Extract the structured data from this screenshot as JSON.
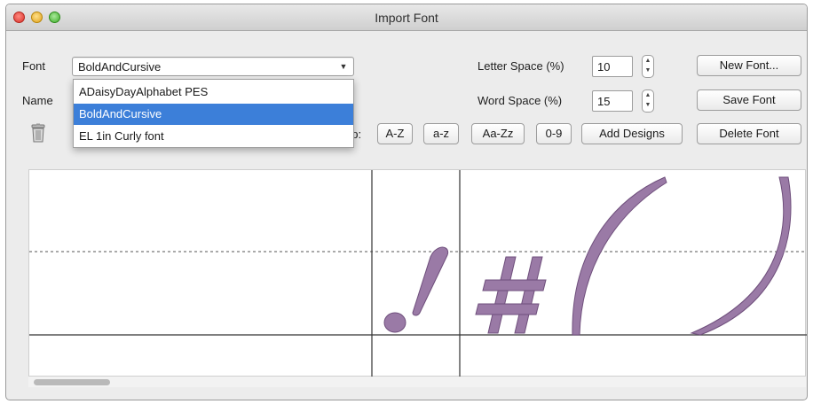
{
  "window": {
    "title": "Import Font"
  },
  "labels": {
    "font": "Font",
    "name": "Name",
    "map_partial": "ap:",
    "letter_space": "Letter Space (%)",
    "word_space": "Word Space (%)"
  },
  "font_select": {
    "selected": "BoldAndCursive",
    "options": [
      "ADaisyDayAlphabet PES",
      "BoldAndCursive",
      "EL 1in Curly font"
    ],
    "highlighted_index": 1
  },
  "letter_space": {
    "value": "10"
  },
  "word_space": {
    "value": "15"
  },
  "buttons": {
    "new_font": "New Font...",
    "save_font": "Save Font",
    "delete_font": "Delete Font",
    "add_designs": "Add Designs",
    "map_az_upper": "A-Z",
    "map_az_lower": "a-z",
    "map_aa_zz": "Aa-Zz",
    "map_09": "0-9"
  },
  "icons": {
    "close": "close-icon",
    "minimize": "minimize-icon",
    "maximize": "maximize-icon",
    "trash": "trash-icon",
    "dropdown": "chevron-down-icon",
    "stepper": "stepper-icon"
  },
  "colors": {
    "glyph_fill": "#9a7aa6",
    "selection": "#3c7fd9"
  }
}
